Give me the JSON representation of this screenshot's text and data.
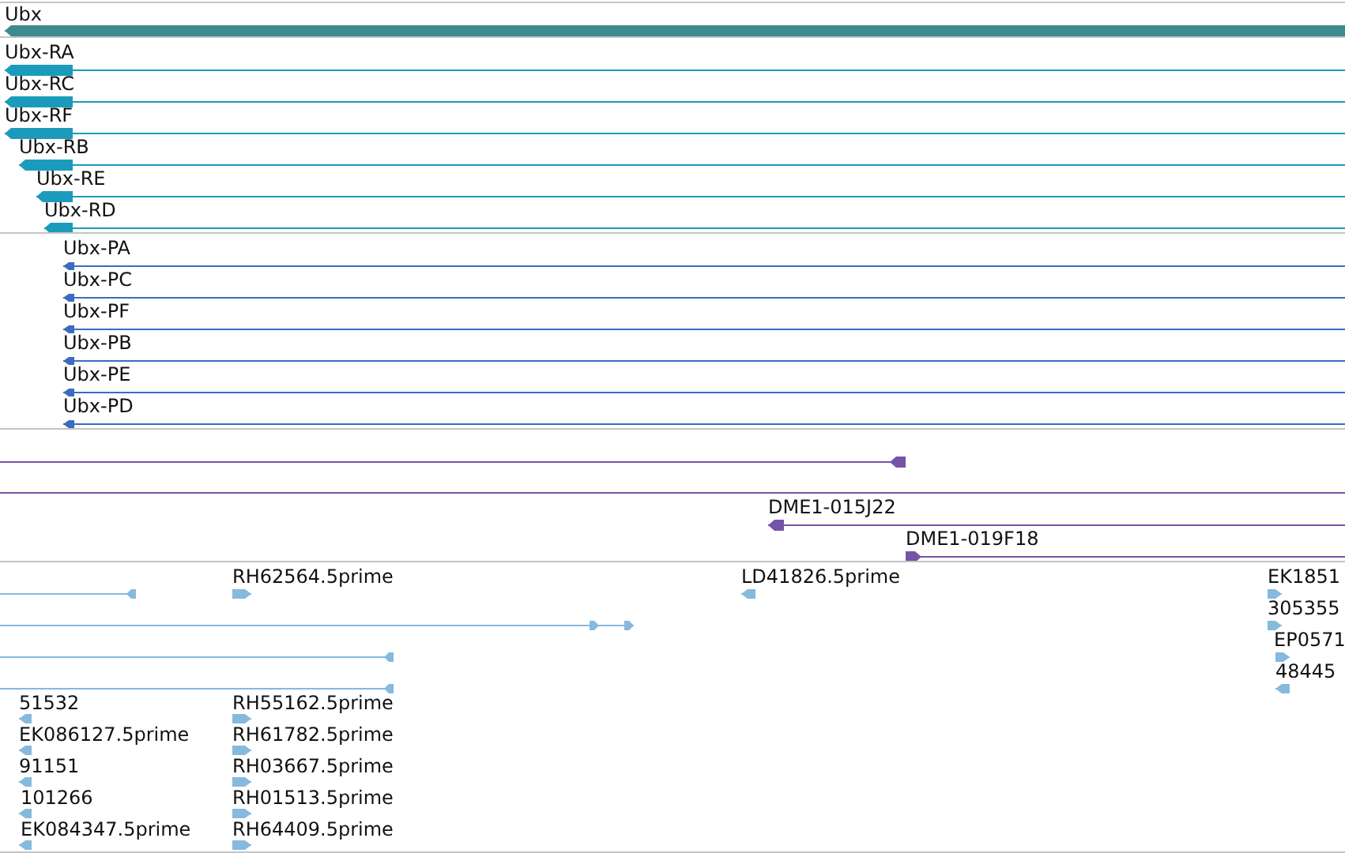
{
  "tracks": [
    {
      "kind": "gene",
      "features": [
        {
          "kind": "arrow",
          "label": "Ubx",
          "reverse": true
        }
      ]
    },
    {
      "kind": "transcript",
      "features": [
        {
          "kind": "arrow",
          "label": "Ubx-RA",
          "reverse": true
        },
        {
          "kind": "arrow",
          "label": "Ubx-RC",
          "reverse": true
        },
        {
          "kind": "arrow",
          "label": "Ubx-RF",
          "reverse": true
        },
        {
          "kind": "arrow",
          "label": "Ubx-RB",
          "reverse": true
        },
        {
          "kind": "arrow",
          "label": "Ubx-RE",
          "reverse": true
        },
        {
          "kind": "arrow",
          "label": "Ubx-RD",
          "reverse": true
        }
      ]
    },
    {
      "kind": "protein",
      "features": [
        {
          "kind": "arrow",
          "label": "Ubx-PA",
          "reverse": true
        },
        {
          "kind": "arrow",
          "label": "Ubx-PC",
          "reverse": true
        },
        {
          "kind": "arrow",
          "label": "Ubx-PF",
          "reverse": true
        },
        {
          "kind": "arrow",
          "label": "Ubx-PB",
          "reverse": true
        },
        {
          "kind": "arrow",
          "label": "Ubx-PE",
          "reverse": true
        },
        {
          "kind": "arrow",
          "label": "Ubx-PD",
          "reverse": true
        }
      ]
    },
    {
      "kind": "clone",
      "features": [
        {
          "kind": "arrow",
          "reverse": true
        },
        {
          "kind": "line"
        },
        {
          "kind": "arrow",
          "label": "DME1-015J22",
          "reverse": true
        },
        {
          "kind": "arrow",
          "label": "DME1-019F18",
          "reverse": false
        }
      ]
    },
    {
      "kind": "est",
      "features": [
        {
          "kind": "arrow",
          "reverse": true
        },
        {
          "kind": "arrow",
          "label": "RH62564.5prime",
          "reverse": false
        },
        {
          "kind": "arrow",
          "label": "LD41826.5prime",
          "reverse": true
        },
        {
          "kind": "arrow",
          "label": "EK1851",
          "reverse": false
        },
        {
          "kind": "arrow",
          "reverse": false
        },
        {
          "kind": "arrow",
          "label": "305355",
          "reverse": false
        },
        {
          "kind": "arrow",
          "reverse": true
        },
        {
          "kind": "arrow",
          "label": "EP0571",
          "reverse": false
        },
        {
          "kind": "arrow",
          "reverse": true
        },
        {
          "kind": "arrow",
          "label": "48445",
          "reverse": true
        },
        {
          "kind": "arrow",
          "label": "51532",
          "reverse": true
        },
        {
          "kind": "arrow",
          "label": "RH55162.5prime",
          "reverse": false
        },
        {
          "kind": "arrow",
          "label": "EK086127.5prime",
          "reverse": true
        },
        {
          "kind": "arrow",
          "label": "RH61782.5prime",
          "reverse": false
        },
        {
          "kind": "arrow",
          "label": "91151",
          "reverse": true
        },
        {
          "kind": "arrow",
          "label": "RH03667.5prime",
          "reverse": false
        },
        {
          "kind": "arrow",
          "label": "101266",
          "reverse": true
        },
        {
          "kind": "arrow",
          "label": "RH01513.5prime",
          "reverse": false
        },
        {
          "kind": "arrow",
          "label": "EK084347.5prime",
          "reverse": true
        },
        {
          "kind": "arrow",
          "label": "RH64409.5prime",
          "reverse": false
        }
      ]
    }
  ]
}
